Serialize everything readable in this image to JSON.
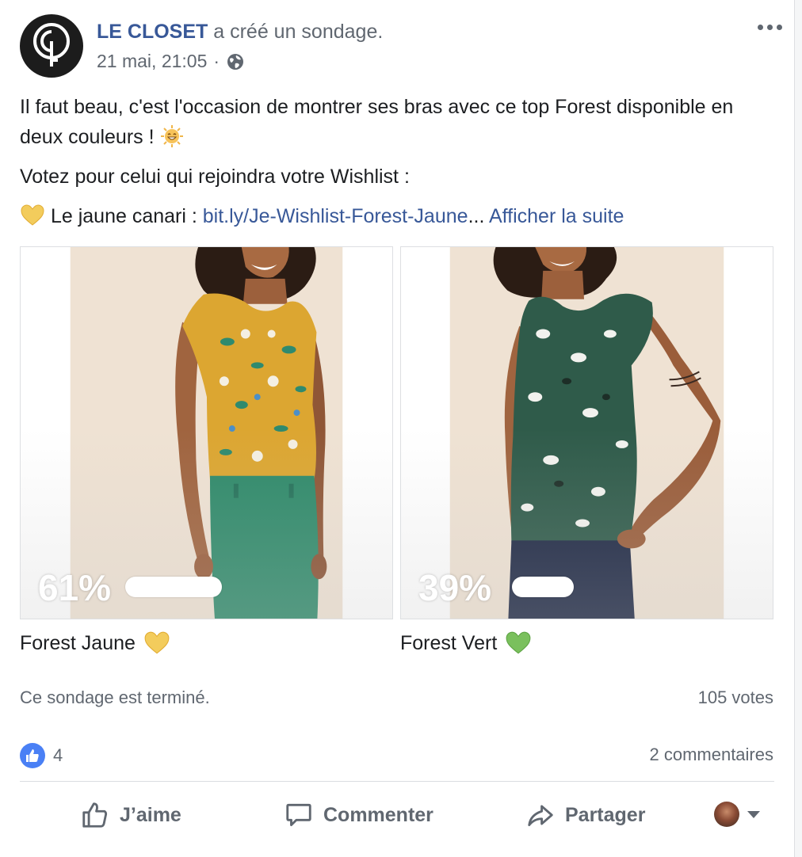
{
  "post": {
    "page_name": "LE CLOSET",
    "action": " a créé un sondage.",
    "date": "21 mai, 21:05",
    "separator": "·",
    "audience_icon": "globe-icon"
  },
  "body": {
    "line1": "Il faut beau, c'est l'occasion de montrer ses bras avec ce top Forest disponible en deux couleurs !",
    "line1_emoji": "smiling-sun-emoji",
    "line2": "Votez pour celui qui rejoindra votre Wishlist :",
    "line3_prefix": "Le jaune canari : ",
    "line3_emoji": "yellow-heart-emoji",
    "link_text": "bit.ly/Je-Wishlist-Forest-Jaune",
    "ellipsis": "...",
    "see_more": "Afficher la suite"
  },
  "poll": {
    "options": [
      {
        "label": "Forest Jaune",
        "percent_text": "61%",
        "percent": 61,
        "heart": "yellow-heart-emoji",
        "heart_color": "#f3cc5c"
      },
      {
        "label": "Forest Vert",
        "percent_text": "39%",
        "percent": 39,
        "heart": "green-heart-emoji",
        "heart_color": "#7ac05d"
      }
    ],
    "status": "Ce sondage est terminé.",
    "votes": "105 votes"
  },
  "engagement": {
    "like_count": "4",
    "comments": "2 commentaires"
  },
  "actions": {
    "like": "J’aime",
    "comment": "Commenter",
    "share": "Partager"
  },
  "colors": {
    "link": "#385898",
    "secondary_text": "#606770",
    "like_badge": "#4a80f5"
  }
}
